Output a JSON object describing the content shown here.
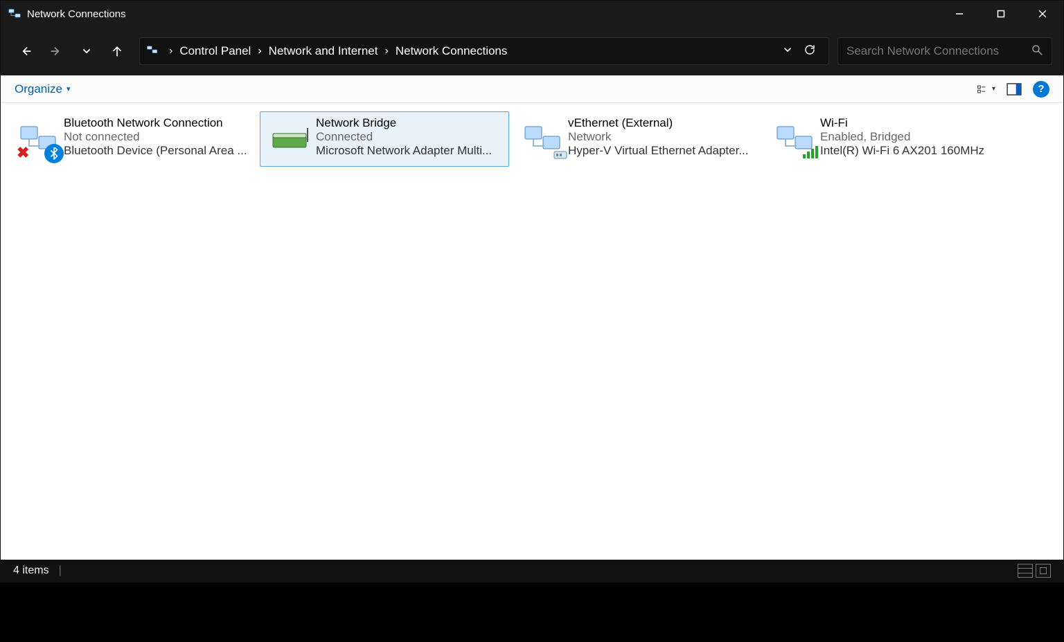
{
  "titlebar": {
    "title": "Network Connections"
  },
  "breadcrumb": {
    "crumb1": "Control Panel",
    "crumb2": "Network and Internet",
    "crumb3": "Network Connections"
  },
  "search": {
    "placeholder": "Search Network Connections"
  },
  "toolbar": {
    "organize": "Organize"
  },
  "connections": {
    "bluetooth": {
      "name": "Bluetooth Network Connection",
      "status": "Not connected",
      "device": "Bluetooth Device (Personal Area ..."
    },
    "bridge": {
      "name": "Network Bridge",
      "status": "Connected",
      "device": "Microsoft Network Adapter Multi..."
    },
    "vethernet": {
      "name": "vEthernet (External)",
      "status": "Network",
      "device": "Hyper-V Virtual Ethernet Adapter..."
    },
    "wifi": {
      "name": "Wi-Fi",
      "status": "Enabled, Bridged",
      "device": "Intel(R) Wi-Fi 6 AX201 160MHz"
    }
  },
  "statusbar": {
    "count": "4 items"
  },
  "help": {
    "label": "?"
  }
}
